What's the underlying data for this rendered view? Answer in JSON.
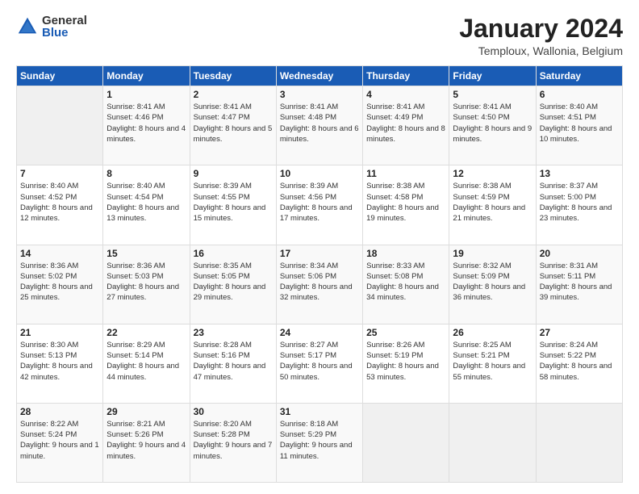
{
  "logo": {
    "general": "General",
    "blue": "Blue"
  },
  "header": {
    "month_year": "January 2024",
    "location": "Temploux, Wallonia, Belgium"
  },
  "days_of_week": [
    "Sunday",
    "Monday",
    "Tuesday",
    "Wednesday",
    "Thursday",
    "Friday",
    "Saturday"
  ],
  "weeks": [
    [
      {
        "day": "",
        "sunrise": "",
        "sunset": "",
        "daylight": ""
      },
      {
        "day": "1",
        "sunrise": "Sunrise: 8:41 AM",
        "sunset": "Sunset: 4:46 PM",
        "daylight": "Daylight: 8 hours and 4 minutes."
      },
      {
        "day": "2",
        "sunrise": "Sunrise: 8:41 AM",
        "sunset": "Sunset: 4:47 PM",
        "daylight": "Daylight: 8 hours and 5 minutes."
      },
      {
        "day": "3",
        "sunrise": "Sunrise: 8:41 AM",
        "sunset": "Sunset: 4:48 PM",
        "daylight": "Daylight: 8 hours and 6 minutes."
      },
      {
        "day": "4",
        "sunrise": "Sunrise: 8:41 AM",
        "sunset": "Sunset: 4:49 PM",
        "daylight": "Daylight: 8 hours and 8 minutes."
      },
      {
        "day": "5",
        "sunrise": "Sunrise: 8:41 AM",
        "sunset": "Sunset: 4:50 PM",
        "daylight": "Daylight: 8 hours and 9 minutes."
      },
      {
        "day": "6",
        "sunrise": "Sunrise: 8:40 AM",
        "sunset": "Sunset: 4:51 PM",
        "daylight": "Daylight: 8 hours and 10 minutes."
      }
    ],
    [
      {
        "day": "7",
        "sunrise": "Sunrise: 8:40 AM",
        "sunset": "Sunset: 4:52 PM",
        "daylight": "Daylight: 8 hours and 12 minutes."
      },
      {
        "day": "8",
        "sunrise": "Sunrise: 8:40 AM",
        "sunset": "Sunset: 4:54 PM",
        "daylight": "Daylight: 8 hours and 13 minutes."
      },
      {
        "day": "9",
        "sunrise": "Sunrise: 8:39 AM",
        "sunset": "Sunset: 4:55 PM",
        "daylight": "Daylight: 8 hours and 15 minutes."
      },
      {
        "day": "10",
        "sunrise": "Sunrise: 8:39 AM",
        "sunset": "Sunset: 4:56 PM",
        "daylight": "Daylight: 8 hours and 17 minutes."
      },
      {
        "day": "11",
        "sunrise": "Sunrise: 8:38 AM",
        "sunset": "Sunset: 4:58 PM",
        "daylight": "Daylight: 8 hours and 19 minutes."
      },
      {
        "day": "12",
        "sunrise": "Sunrise: 8:38 AM",
        "sunset": "Sunset: 4:59 PM",
        "daylight": "Daylight: 8 hours and 21 minutes."
      },
      {
        "day": "13",
        "sunrise": "Sunrise: 8:37 AM",
        "sunset": "Sunset: 5:00 PM",
        "daylight": "Daylight: 8 hours and 23 minutes."
      }
    ],
    [
      {
        "day": "14",
        "sunrise": "Sunrise: 8:36 AM",
        "sunset": "Sunset: 5:02 PM",
        "daylight": "Daylight: 8 hours and 25 minutes."
      },
      {
        "day": "15",
        "sunrise": "Sunrise: 8:36 AM",
        "sunset": "Sunset: 5:03 PM",
        "daylight": "Daylight: 8 hours and 27 minutes."
      },
      {
        "day": "16",
        "sunrise": "Sunrise: 8:35 AM",
        "sunset": "Sunset: 5:05 PM",
        "daylight": "Daylight: 8 hours and 29 minutes."
      },
      {
        "day": "17",
        "sunrise": "Sunrise: 8:34 AM",
        "sunset": "Sunset: 5:06 PM",
        "daylight": "Daylight: 8 hours and 32 minutes."
      },
      {
        "day": "18",
        "sunrise": "Sunrise: 8:33 AM",
        "sunset": "Sunset: 5:08 PM",
        "daylight": "Daylight: 8 hours and 34 minutes."
      },
      {
        "day": "19",
        "sunrise": "Sunrise: 8:32 AM",
        "sunset": "Sunset: 5:09 PM",
        "daylight": "Daylight: 8 hours and 36 minutes."
      },
      {
        "day": "20",
        "sunrise": "Sunrise: 8:31 AM",
        "sunset": "Sunset: 5:11 PM",
        "daylight": "Daylight: 8 hours and 39 minutes."
      }
    ],
    [
      {
        "day": "21",
        "sunrise": "Sunrise: 8:30 AM",
        "sunset": "Sunset: 5:13 PM",
        "daylight": "Daylight: 8 hours and 42 minutes."
      },
      {
        "day": "22",
        "sunrise": "Sunrise: 8:29 AM",
        "sunset": "Sunset: 5:14 PM",
        "daylight": "Daylight: 8 hours and 44 minutes."
      },
      {
        "day": "23",
        "sunrise": "Sunrise: 8:28 AM",
        "sunset": "Sunset: 5:16 PM",
        "daylight": "Daylight: 8 hours and 47 minutes."
      },
      {
        "day": "24",
        "sunrise": "Sunrise: 8:27 AM",
        "sunset": "Sunset: 5:17 PM",
        "daylight": "Daylight: 8 hours and 50 minutes."
      },
      {
        "day": "25",
        "sunrise": "Sunrise: 8:26 AM",
        "sunset": "Sunset: 5:19 PM",
        "daylight": "Daylight: 8 hours and 53 minutes."
      },
      {
        "day": "26",
        "sunrise": "Sunrise: 8:25 AM",
        "sunset": "Sunset: 5:21 PM",
        "daylight": "Daylight: 8 hours and 55 minutes."
      },
      {
        "day": "27",
        "sunrise": "Sunrise: 8:24 AM",
        "sunset": "Sunset: 5:22 PM",
        "daylight": "Daylight: 8 hours and 58 minutes."
      }
    ],
    [
      {
        "day": "28",
        "sunrise": "Sunrise: 8:22 AM",
        "sunset": "Sunset: 5:24 PM",
        "daylight": "Daylight: 9 hours and 1 minute."
      },
      {
        "day": "29",
        "sunrise": "Sunrise: 8:21 AM",
        "sunset": "Sunset: 5:26 PM",
        "daylight": "Daylight: 9 hours and 4 minutes."
      },
      {
        "day": "30",
        "sunrise": "Sunrise: 8:20 AM",
        "sunset": "Sunset: 5:28 PM",
        "daylight": "Daylight: 9 hours and 7 minutes."
      },
      {
        "day": "31",
        "sunrise": "Sunrise: 8:18 AM",
        "sunset": "Sunset: 5:29 PM",
        "daylight": "Daylight: 9 hours and 11 minutes."
      },
      {
        "day": "",
        "sunrise": "",
        "sunset": "",
        "daylight": ""
      },
      {
        "day": "",
        "sunrise": "",
        "sunset": "",
        "daylight": ""
      },
      {
        "day": "",
        "sunrise": "",
        "sunset": "",
        "daylight": ""
      }
    ]
  ]
}
